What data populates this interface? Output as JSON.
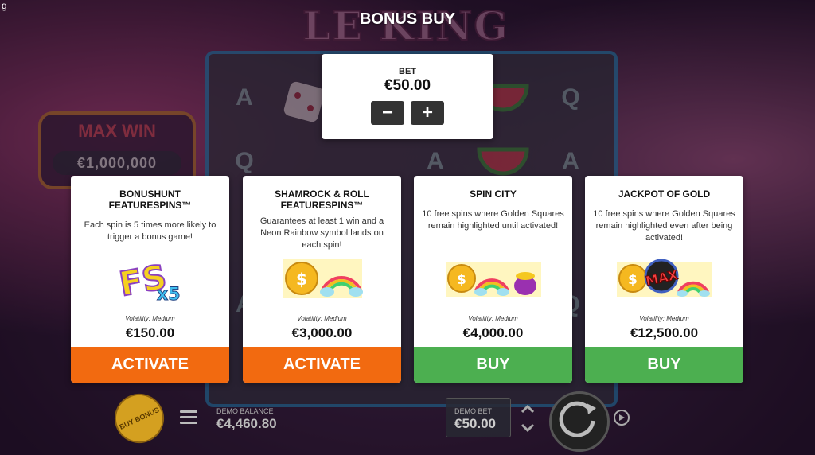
{
  "corner_text": "g",
  "game": {
    "logo_text": "LE KING",
    "max_win_title": "MAX WIN",
    "max_win_value": "€1,000,000",
    "reel_symbols": [
      "A",
      "Q",
      "Q",
      "A",
      "A",
      "Q",
      "A"
    ]
  },
  "overlay": {
    "title": "BONUS BUY",
    "bet_label": "BET",
    "bet_value": "€50.00",
    "decrease_label": "−",
    "increase_label": "+"
  },
  "cards": [
    {
      "title": "BONUSHUNT FEATURESPINS™",
      "description": "Each spin is 5 times more likely to trigger a bonus game!",
      "volatility": "Volatility: Medium",
      "price": "€150.00",
      "button": "ACTIVATE",
      "button_color": "#f26a10",
      "art": "fs-x5-icon"
    },
    {
      "title": "SHAMROCK & ROLL FEATURESPINS™",
      "description": "Guarantees at least 1 win and a Neon Rainbow symbol lands on each spin!",
      "volatility": "Volatility: Medium",
      "price": "€3,000.00",
      "button": "ACTIVATE",
      "button_color": "#f26a10",
      "art": "coin-rainbow-icon"
    },
    {
      "title": "SPIN CITY",
      "description": "10 free spins where Golden Squares remain highlighted until activated!",
      "volatility": "Volatility: Medium",
      "price": "€4,000.00",
      "button": "BUY",
      "button_color": "#4caf50",
      "art": "coin-rainbow-pot-icon"
    },
    {
      "title": "JACKPOT OF GOLD",
      "description": "10 free spins where Golden Squares remain highlighted even after being activated!",
      "volatility": "Volatility: Medium",
      "price": "€12,500.00",
      "button": "BUY",
      "button_color": "#4caf50",
      "art": "coin-max-rainbow-icon"
    }
  ],
  "bottom_bar": {
    "buy_bonus_label": "BUY BONUS",
    "demo_balance_label": "DEMO BALANCE",
    "demo_balance_value": "€4,460.80",
    "demo_bet_label": "DEMO BET",
    "demo_bet_value": "€50.00"
  },
  "colors": {
    "activate": "#f26a10",
    "buy": "#4caf50",
    "coin": "#f5b820"
  }
}
